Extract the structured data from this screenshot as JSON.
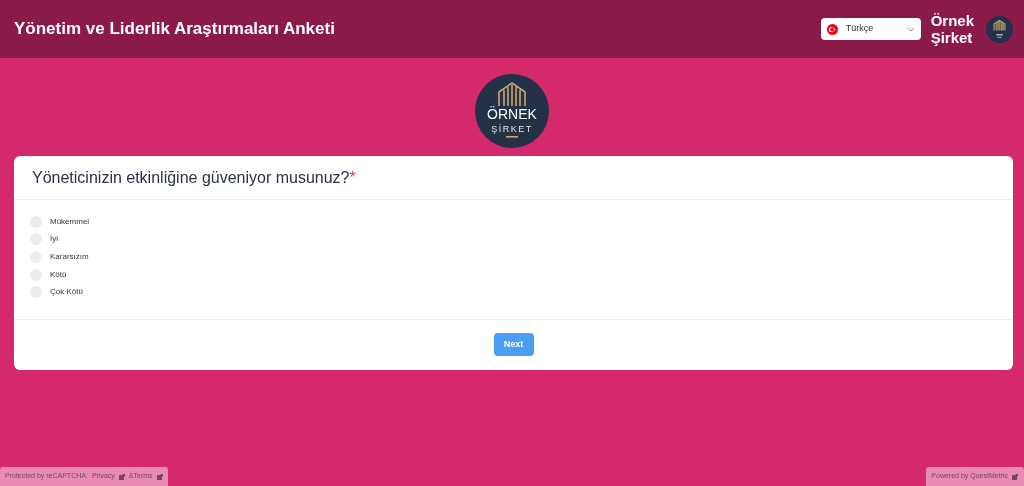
{
  "header": {
    "title": "Yönetim ve Liderlik Araştırmaları Anketi",
    "language": {
      "value": "Türkçe"
    },
    "company": [
      "Örnek",
      "Şirket"
    ]
  },
  "logo": {
    "line1": "ÖRNEK",
    "line2": "ŞİRKET"
  },
  "question": {
    "text": "Yöneticinizin etkinliğine güveniyor musunuz?",
    "required_mark": "*",
    "options": [
      {
        "label": "Mükemmel",
        "selected": false
      },
      {
        "label": "İyi",
        "selected": false
      },
      {
        "label": "Kararsızım",
        "selected": false
      },
      {
        "label": "Kötü",
        "selected": false
      },
      {
        "label": "Çok Kötü",
        "selected": false
      }
    ]
  },
  "next_button": "Next",
  "footer": {
    "recaptcha": {
      "text": "Protected by reCAPTCHA:",
      "links": [
        "Privacy",
        "&Terms"
      ]
    },
    "powered_by": "Powered by QuestMetric"
  }
}
